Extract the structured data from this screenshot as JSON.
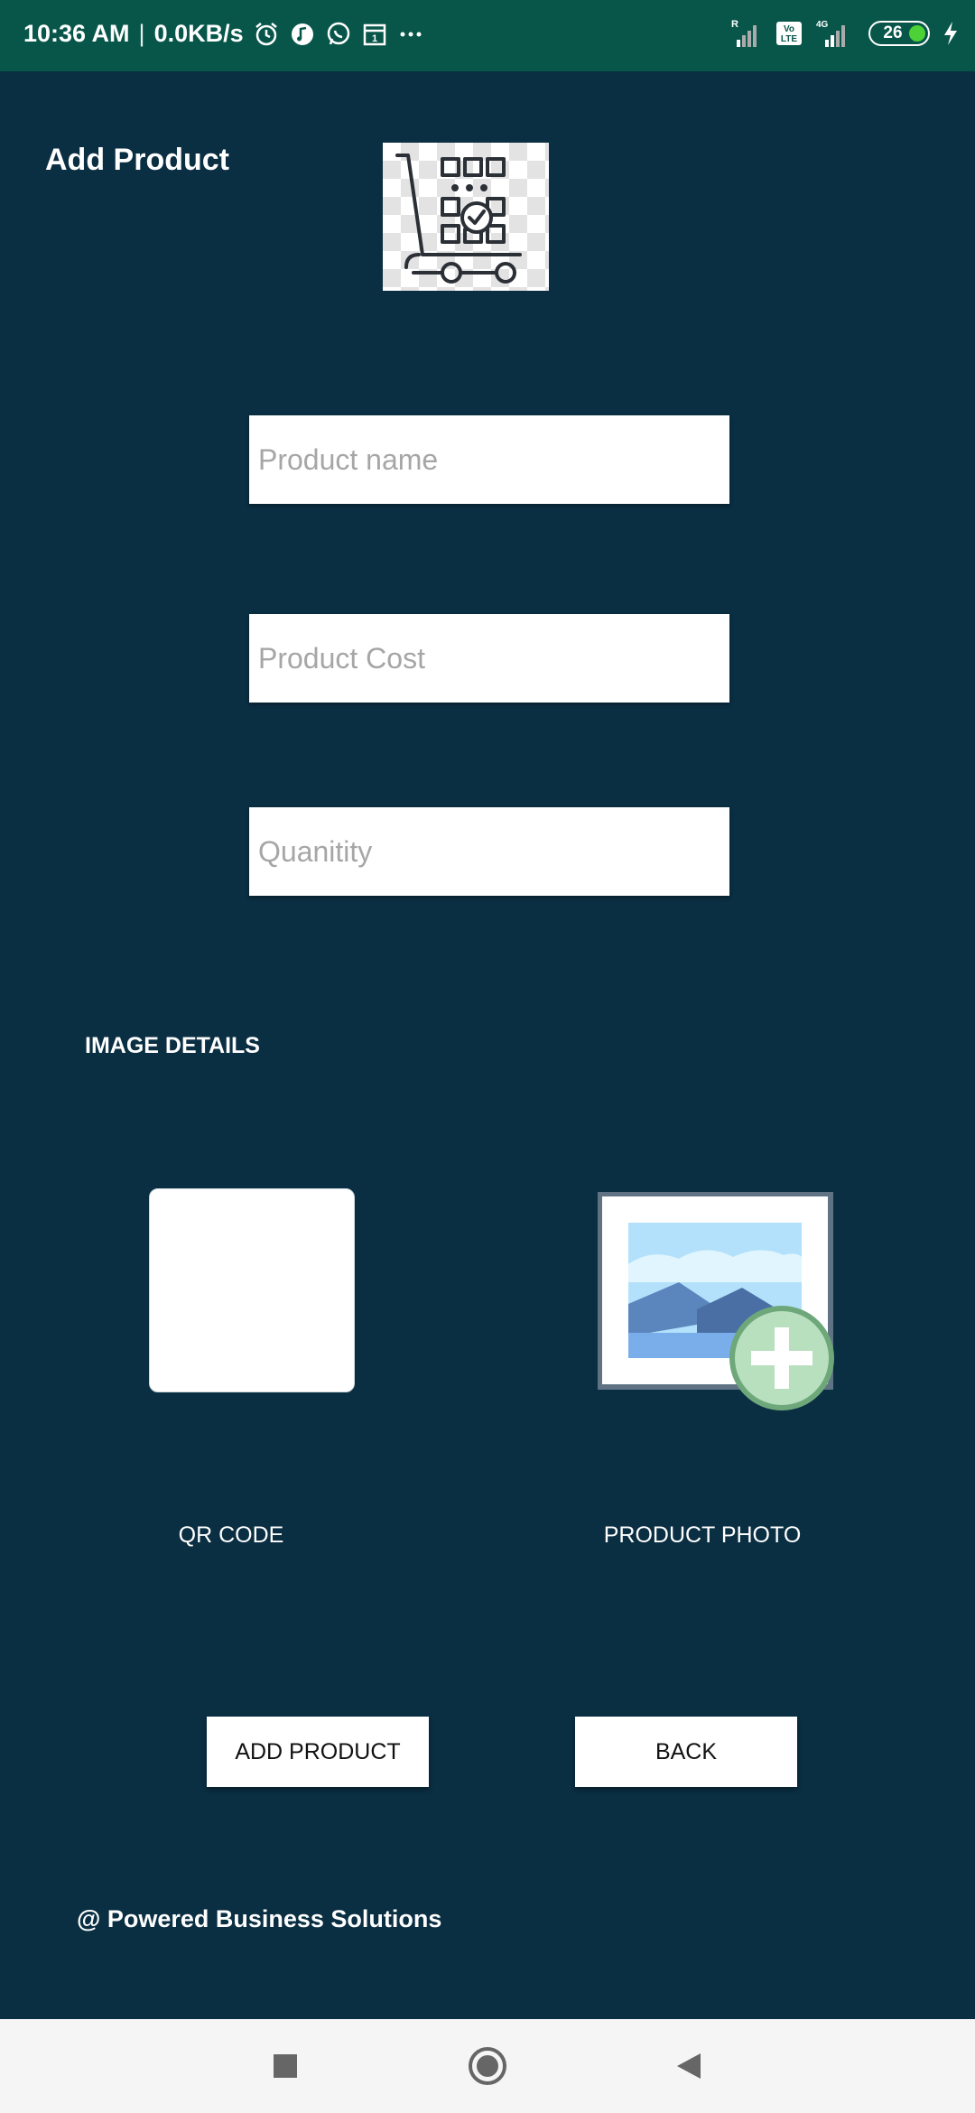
{
  "status_bar": {
    "time": "10:36 AM",
    "network_speed": "0.0KB/s",
    "battery_level": "26",
    "icons": [
      "alarm-icon",
      "music-icon",
      "whatsapp-icon",
      "calendar-icon",
      "more-icon",
      "signal-icon",
      "volte-icon",
      "4g-signal-icon",
      "battery-icon",
      "charging-icon"
    ]
  },
  "header": {
    "title": "Add Product",
    "logo_icon": "cart-boxes-icon"
  },
  "form": {
    "product_name_placeholder": "Product name",
    "product_cost_placeholder": "Product Cost",
    "quantity_placeholder": "Quanitity"
  },
  "image_details": {
    "section_title": "IMAGE DETAILS",
    "qr_label": "QR CODE",
    "photo_label": "PRODUCT PHOTO",
    "photo_icon": "add-photo-icon"
  },
  "actions": {
    "add_label": "ADD PRODUCT",
    "back_label": "BACK"
  },
  "footer": {
    "text": "@ Powered Business Solutions"
  },
  "colors": {
    "background": "#0a2e42",
    "status_bar": "#08564a",
    "add_badge": "#b8dfbe"
  }
}
